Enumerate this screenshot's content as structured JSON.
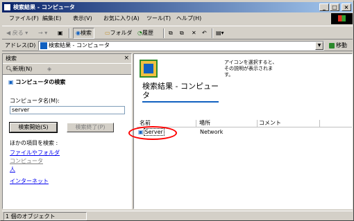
{
  "window": {
    "title": "検索結果 - コンピュータ"
  },
  "menu": [
    "ファイル(F)",
    "編集(E)",
    "表示(V)",
    "お気に入り(A)",
    "ツール(T)",
    "ヘルプ(H)"
  ],
  "toolbar": {
    "back": "戻る",
    "forward": "→",
    "search": "検索",
    "folders": "フォルダ",
    "history": "履歴"
  },
  "address": {
    "label": "アドレス(D)",
    "value": "検索結果 - コンピュータ",
    "go": "移動"
  },
  "search_pane": {
    "title": "検索",
    "close": "×",
    "new": "新規(N)",
    "heading": "コンピュータの検索",
    "name_label": "コンピュータ名(M):",
    "name_value": "server",
    "start": "検索開始(S)",
    "stop": "検索終了(P)",
    "other_label": "ほかの項目を検索 :",
    "links": [
      "ファイルやフォルダ",
      "コンピュータ",
      "人",
      "インターネット"
    ]
  },
  "results": {
    "banner_title": "検索結果 - コンピュータ",
    "hint": "アイコンを選択すると、その説明が表示されます。",
    "columns": [
      "名前",
      "場所",
      "コメント"
    ],
    "rows": [
      {
        "name": "Server",
        "location": "Network",
        "comment": ""
      }
    ]
  },
  "status": {
    "text": "1 個のオブジェクト"
  },
  "colors": {
    "title_start": "#0a246a",
    "highlight": "#ff0000",
    "link": "#0000ee"
  }
}
